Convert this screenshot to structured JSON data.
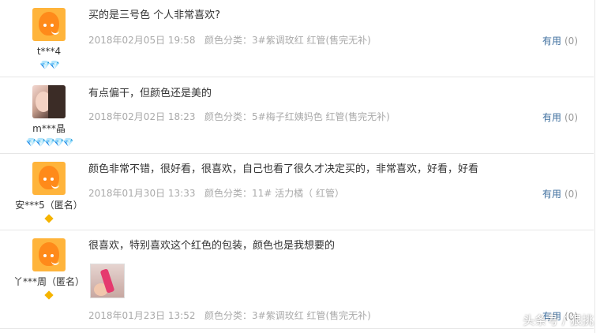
{
  "reviews": [
    {
      "nickname": "t***4",
      "badge_icons": "💎💎",
      "content": "买的是三号色 个人非常喜欢?",
      "date": "2018年02月05日 19:58",
      "sku": "颜色分类：3#紫调玫红 红管(售完无补)",
      "useful_label": "有用",
      "useful_count": "(0)"
    },
    {
      "nickname": "m***晶",
      "badge_icons": "💎💎💎💎💎",
      "content": "有点偏干，但颜色还是美的",
      "date": "2018年02月02日 18:23",
      "sku": "颜色分类：5#梅子红姨妈色 红管(售完无补)",
      "useful_label": "有用",
      "useful_count": "(0)"
    },
    {
      "nickname": "安***5（匿名）",
      "content": "颜色非常不错，很好看，很喜欢，自己也看了很久才决定买的，非常喜欢，好看，好看",
      "date": "2018年01月30日 13:33",
      "sku": "颜色分类：11# 活力橘（ 红管）",
      "useful_label": "有用",
      "useful_count": "(0)"
    },
    {
      "nickname": "丫***周（匿名）",
      "content": "很喜欢，特别喜欢这个红色的包装，颜色也是我想要的",
      "date": "2018年01月23日 13:52",
      "sku": "颜色分类：3#紫调玫红 红管(售完无补)",
      "useful_label": "有用",
      "useful_count": "(0)"
    }
  ],
  "watermark": "头条号 / 狠挑",
  "colors": {
    "useful_link": "#3d6e9e",
    "meta_text": "#aaaaaa",
    "divider": "#e6e6e6",
    "avatar_orange": "#ffb43b"
  }
}
